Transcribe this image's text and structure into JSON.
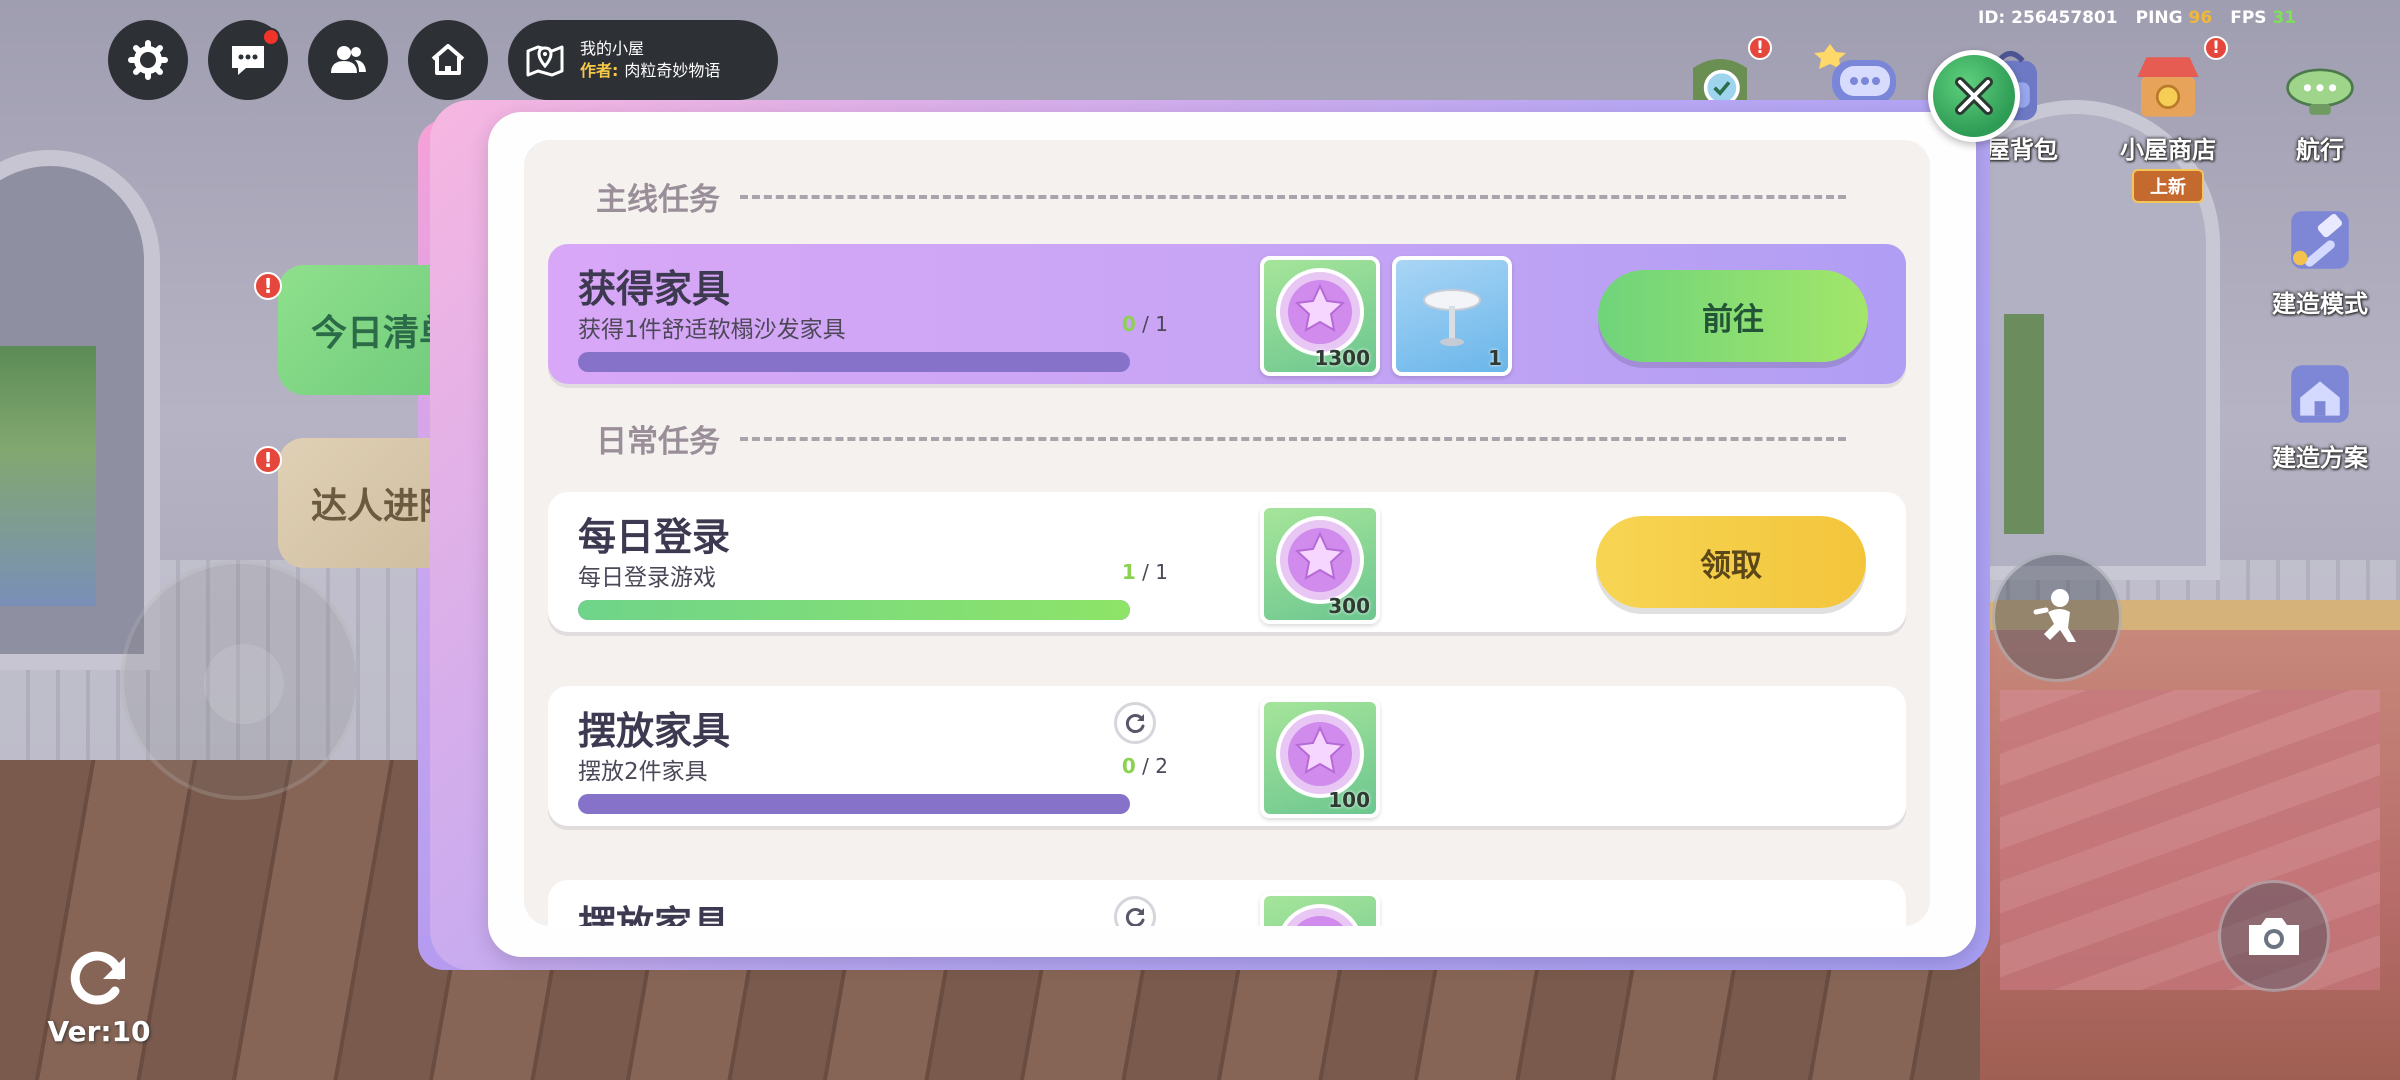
{
  "stats": {
    "id_label": "ID:",
    "id_value": "256457801",
    "ping_label": "PING",
    "ping_value": "96",
    "fps_label": "FPS",
    "fps_value": "31"
  },
  "top_bar": {
    "buttons": [
      "settings-icon",
      "chat-icon",
      "friends-icon",
      "home-icon"
    ],
    "location": {
      "title": "我的小屋",
      "author_label": "作者:",
      "author_name": "肉粒奇妙物语"
    }
  },
  "right_menu": [
    {
      "icon": "achievement-icon",
      "label": ""
    },
    {
      "icon": "chat-bubble-icon",
      "label": ""
    },
    {
      "icon": "backpack-icon",
      "label": "小屋背包"
    },
    {
      "icon": "shop-icon",
      "label": "小屋商店",
      "tag": "上新"
    },
    {
      "icon": "airship-icon",
      "label": "航行"
    },
    {
      "icon": "build-mode-icon",
      "label": "建造模式"
    },
    {
      "icon": "build-plan-icon",
      "label": "建造方案"
    }
  ],
  "side_tabs": [
    {
      "label": "今日清单"
    },
    {
      "label": "达人进阶"
    }
  ],
  "version": "Ver:10",
  "modal": {
    "main_section": "主线任务",
    "daily_section": "日常任务",
    "tasks": [
      {
        "title": "获得家具",
        "desc": "获得1件舒适软榻沙发家具",
        "current": "0",
        "total": "/ 1",
        "progress": 0,
        "rewards": [
          {
            "icon": "star-coin-icon",
            "qty": "1300"
          },
          {
            "icon": "round-table-icon",
            "qty": "1"
          }
        ],
        "action": "前往"
      },
      {
        "title": "每日登录",
        "desc": "每日登录游戏",
        "current": "1",
        "total": "/ 1",
        "progress": 1,
        "rewards": [
          {
            "icon": "star-coin-icon",
            "qty": "300"
          }
        ],
        "action": "领取"
      },
      {
        "title": "摆放家具",
        "desc": "摆放2件家具",
        "current": "0",
        "total": "/ 2",
        "progress": 0,
        "rewards": [
          {
            "icon": "star-coin-icon",
            "qty": "100"
          }
        ]
      },
      {
        "title": "摆放家具"
      }
    ]
  }
}
